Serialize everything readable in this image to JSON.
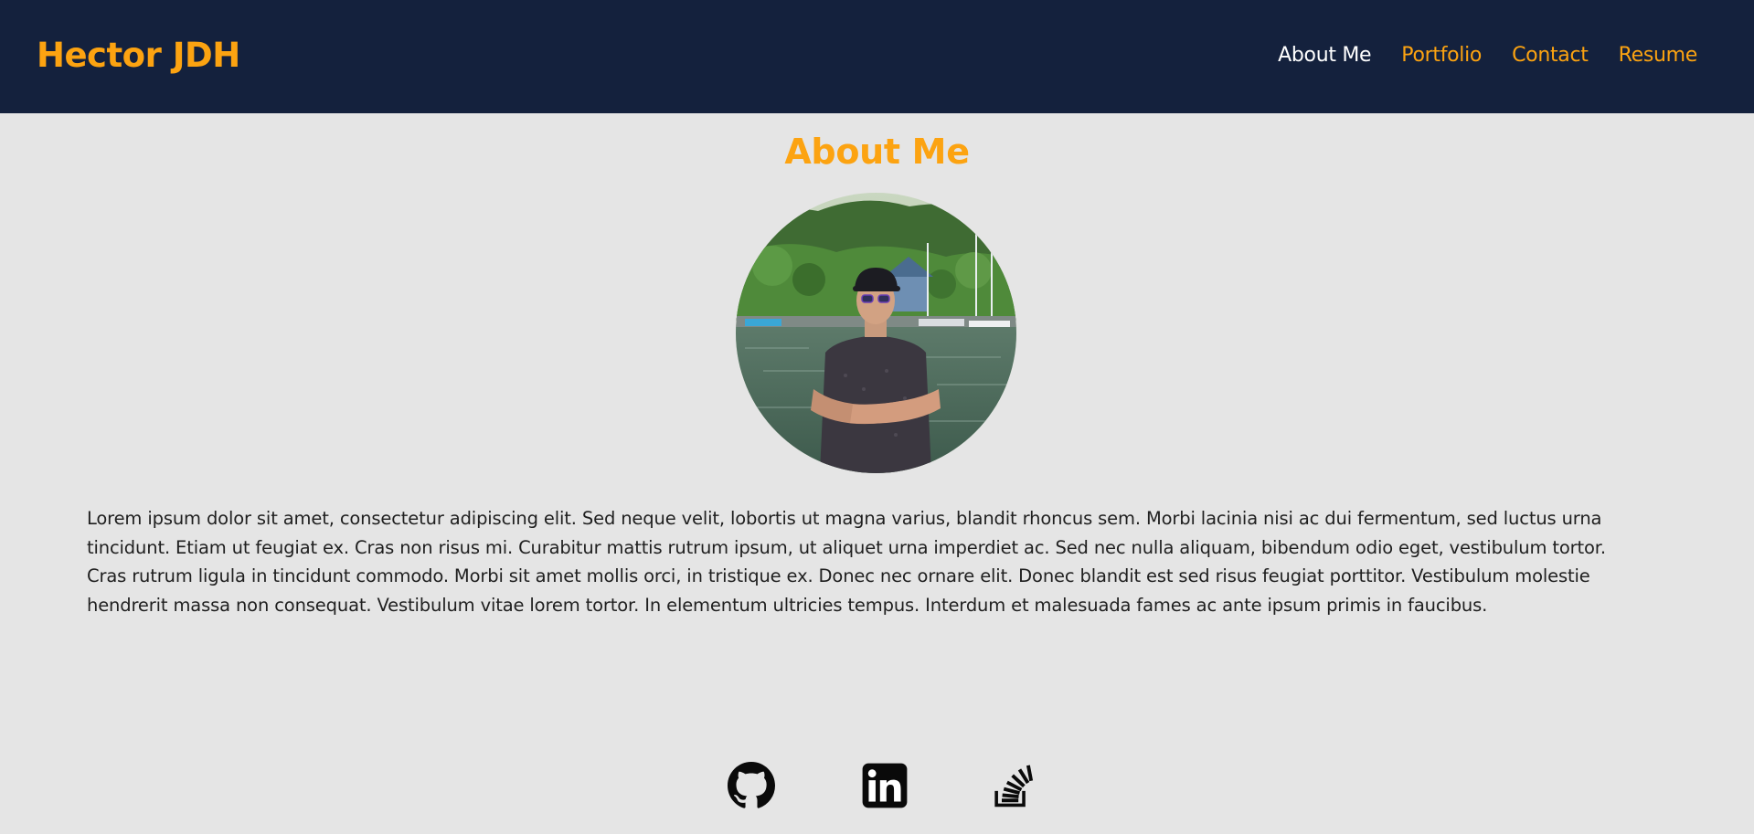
{
  "header": {
    "brand": "Hector JDH",
    "nav": [
      {
        "label": "About Me",
        "active": true
      },
      {
        "label": "Portfolio",
        "active": false
      },
      {
        "label": "Contact",
        "active": false
      },
      {
        "label": "Resume",
        "active": false
      }
    ]
  },
  "about": {
    "title": "About Me",
    "avatar_icon": "profile-photo",
    "bio": "Lorem ipsum dolor sit amet, consectetur adipiscing elit. Sed neque velit, lobortis ut magna varius, blandit rhoncus sem. Morbi lacinia nisi ac dui fermentum, sed luctus urna tincidunt. Etiam ut feugiat ex. Cras non risus mi. Curabitur mattis rutrum ipsum, ut aliquet urna imperdiet ac. Sed nec nulla aliquam, bibendum odio eget, vestibulum tortor. Cras rutrum ligula in tincidunt commodo. Morbi sit amet mollis orci, in tristique ex. Donec nec ornare elit. Donec blandit est sed risus feugiat porttitor. Vestibulum molestie hendrerit massa non consequat. Vestibulum vitae lorem tortor. In elementum ultricies tempus. Interdum et malesuada fames ac ante ipsum primis in faucibus."
  },
  "footer": {
    "socials": [
      {
        "icon": "github-icon"
      },
      {
        "icon": "linkedin-icon"
      },
      {
        "icon": "stackoverflow-icon"
      }
    ]
  },
  "colors": {
    "header_bg": "#14213d",
    "accent": "#fca311",
    "page_bg": "#e5e5e5",
    "active_nav": "#ffffff"
  }
}
